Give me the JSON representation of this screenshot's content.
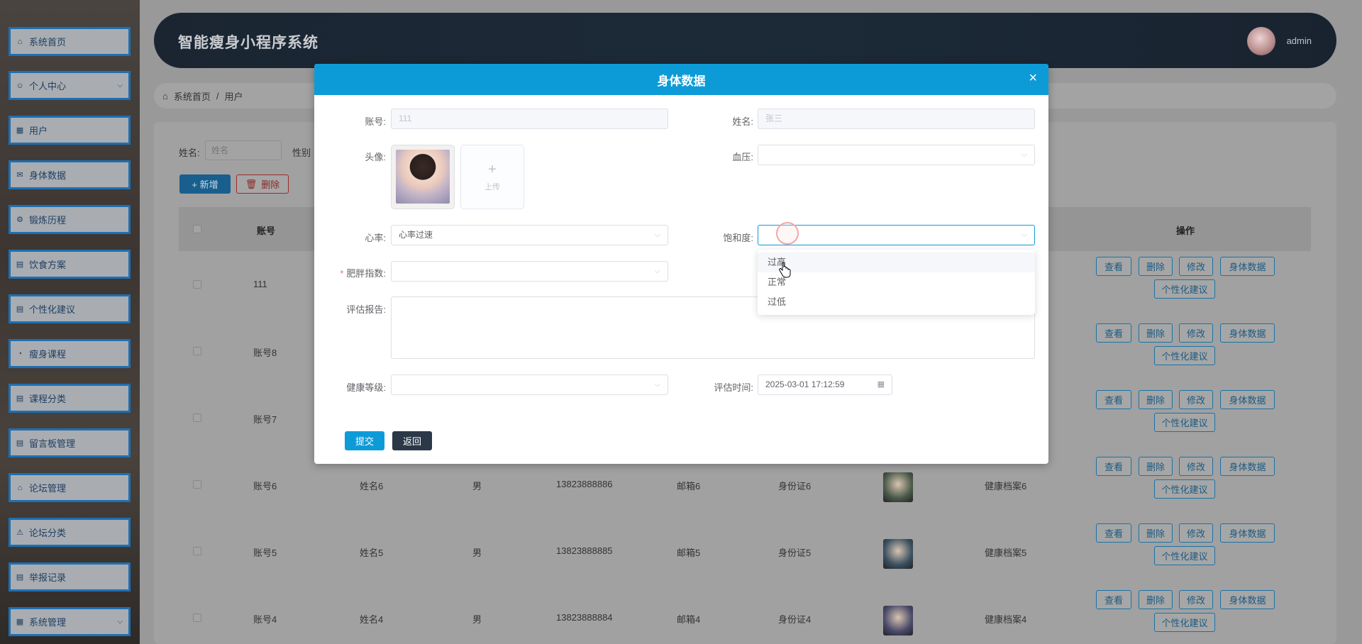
{
  "app": {
    "title": "智能瘦身小程序系统",
    "user": "admin"
  },
  "colors": {
    "modal_header": "#0d9bd8",
    "sidebar_border": "#1d6fb3",
    "header_bg": "#1b2532",
    "submit": "#0d9bd8",
    "back": "#2b3848"
  },
  "sidebar": {
    "items": [
      {
        "label": "系统首页",
        "icon": "home-icon"
      },
      {
        "label": "个人中心",
        "icon": "user-icon",
        "expandable": true
      },
      {
        "label": "用户",
        "icon": "grid-icon"
      },
      {
        "label": "身体数据",
        "icon": "mail-icon"
      },
      {
        "label": "锻炼历程",
        "icon": "gear-icon"
      },
      {
        "label": "饮食方案",
        "icon": "chart-icon"
      },
      {
        "label": "个性化建议",
        "icon": "chart-icon"
      },
      {
        "label": "瘦身课程",
        "icon": "clock-icon"
      },
      {
        "label": "课程分类",
        "icon": "chart-icon"
      },
      {
        "label": "留言板管理",
        "icon": "chart-icon"
      },
      {
        "label": "论坛管理",
        "icon": "bank-icon"
      },
      {
        "label": "论坛分类",
        "icon": "warning-icon"
      },
      {
        "label": "举报记录",
        "icon": "chart-icon"
      },
      {
        "label": "系统管理",
        "icon": "grid-icon",
        "expandable": true
      }
    ]
  },
  "breadcrumb": {
    "home": "系统首页",
    "separator": "/",
    "current": "用户"
  },
  "search": {
    "name_label": "姓名:",
    "name_placeholder": "姓名",
    "gender_label": "性别"
  },
  "toolbar": {
    "add": "+ 新增",
    "delete": "删除"
  },
  "table": {
    "headers": {
      "account": "账号",
      "operation": "操作"
    },
    "rows": [
      {
        "account": "111",
        "name": "",
        "gender": "",
        "phone": "",
        "email": "",
        "idcard": "",
        "record": ""
      },
      {
        "account": "账号8",
        "name": "",
        "gender": "",
        "phone": "",
        "email": "",
        "idcard": "",
        "record": ""
      },
      {
        "account": "账号7",
        "name": "",
        "gender": "",
        "phone": "",
        "email": "",
        "idcard": "",
        "record": ""
      },
      {
        "account": "账号6",
        "name": "姓名6",
        "gender": "男",
        "phone": "13823888886",
        "email": "邮箱6",
        "idcard": "身份证6",
        "record": "健康档案6"
      },
      {
        "account": "账号5",
        "name": "姓名5",
        "gender": "男",
        "phone": "13823888885",
        "email": "邮箱5",
        "idcard": "身份证5",
        "record": "健康档案5"
      },
      {
        "account": "账号4",
        "name": "姓名4",
        "gender": "男",
        "phone": "13823888884",
        "email": "邮箱4",
        "idcard": "身份证4",
        "record": "健康档案4"
      }
    ],
    "ops": {
      "view": "查看",
      "delete": "删除",
      "edit": "修改",
      "body_data": "身体数据",
      "advice": "个性化建议"
    }
  },
  "modal": {
    "title": "身体数据",
    "close": "×",
    "fields": {
      "account_label": "账号:",
      "account_value": "111",
      "name_label": "姓名:",
      "name_value": "张三",
      "avatar_label": "头像:",
      "upload_text": "上传",
      "blood_pressure_label": "血压:",
      "heart_rate_label": "心率:",
      "heart_rate_value": "心率过速",
      "saturation_label": "饱和度:",
      "obesity_label": "肥胖指数:",
      "report_label": "评估报告:",
      "health_level_label": "健康等级:",
      "eval_time_label": "评估时间:",
      "eval_time_value": "2025-03-01 17:12:59"
    },
    "dropdown_options": [
      "过高",
      "正常",
      "过低"
    ],
    "submit": "提交",
    "back": "返回"
  }
}
